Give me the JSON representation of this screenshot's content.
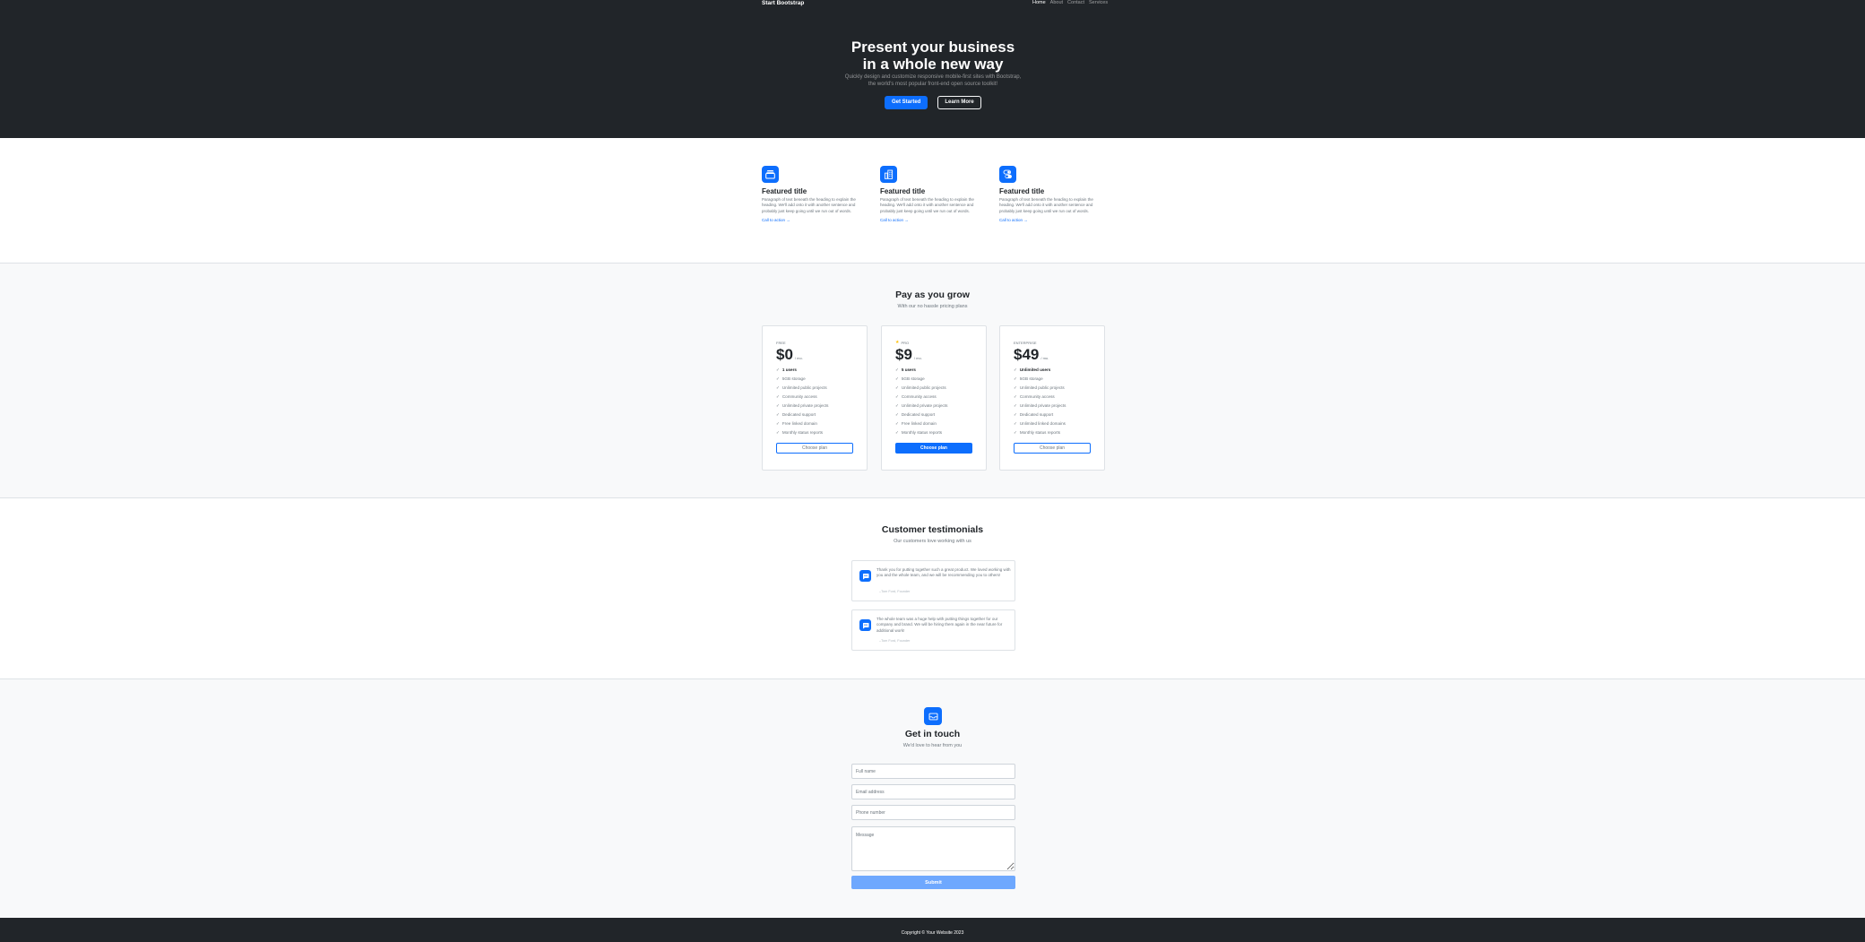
{
  "navbar": {
    "brand": "Start Bootstrap",
    "links": [
      {
        "label": "Home",
        "active": true
      },
      {
        "label": "About",
        "active": false
      },
      {
        "label": "Contact",
        "active": false
      },
      {
        "label": "Services",
        "active": false
      }
    ]
  },
  "hero": {
    "title": "Present your business in a whole new way",
    "lead": "Quickly design and customize responsive mobile-first sites with Bootstrap, the world's most popular front-end open source toolkit!",
    "primary_button": "Get Started",
    "secondary_button": "Learn More"
  },
  "features": [
    {
      "icon": "collection-icon",
      "title": "Featured title",
      "text": "Paragraph of text beneath the heading to explain the heading. We'll add onto it with another sentence and probably just keep going until we run out of words.",
      "link": "Call to action →"
    },
    {
      "icon": "building-icon",
      "title": "Featured title",
      "text": "Paragraph of text beneath the heading to explain the heading. We'll add onto it with another sentence and probably just keep going until we run out of words.",
      "link": "Call to action →"
    },
    {
      "icon": "toggles-icon",
      "title": "Featured title",
      "text": "Paragraph of text beneath the heading to explain the heading. We'll add onto it with another sentence and probably just keep going until we run out of words.",
      "link": "Call to action →"
    }
  ],
  "pricing": {
    "title": "Pay as you grow",
    "subtitle": "With our no hassle pricing plans",
    "check_glyph": "✓",
    "star_glyph": "★",
    "plans": [
      {
        "name": "Free",
        "price": "$0",
        "unit": "/ mo.",
        "featured": false,
        "button": "Choose plan",
        "features": [
          {
            "text": "1 users",
            "strong": true
          },
          {
            "text": "5GB storage",
            "strong": false
          },
          {
            "text": "Unlimited public projects",
            "strong": false
          },
          {
            "text": "Community access",
            "strong": false
          },
          {
            "text": "Unlimited private projects",
            "strong": false
          },
          {
            "text": "Dedicated support",
            "strong": false
          },
          {
            "text": "Free linked domain",
            "strong": false
          },
          {
            "text": "Monthly status reports",
            "strong": false
          }
        ]
      },
      {
        "name": "Pro",
        "price": "$9",
        "unit": "/ mo.",
        "featured": true,
        "button": "Choose plan",
        "features": [
          {
            "text": "5 users",
            "strong": true
          },
          {
            "text": "5GB storage",
            "strong": false
          },
          {
            "text": "Unlimited public projects",
            "strong": false
          },
          {
            "text": "Community access",
            "strong": false
          },
          {
            "text": "Unlimited private projects",
            "strong": false
          },
          {
            "text": "Dedicated support",
            "strong": false
          },
          {
            "text": "Free linked domain",
            "strong": false
          },
          {
            "text": "Monthly status reports",
            "strong": false
          }
        ]
      },
      {
        "name": "Enterprise",
        "price": "$49",
        "unit": "/ mo.",
        "featured": false,
        "button": "Choose plan",
        "features": [
          {
            "text": "Unlimited users",
            "strong": true
          },
          {
            "text": "5GB storage",
            "strong": false
          },
          {
            "text": "Unlimited public projects",
            "strong": false
          },
          {
            "text": "Community access",
            "strong": false
          },
          {
            "text": "Unlimited private projects",
            "strong": false
          },
          {
            "text": "Dedicated support",
            "strong": false
          },
          {
            "text": "Unlimited linked domains",
            "strong": false
          },
          {
            "text": "Monthly status reports",
            "strong": false
          }
        ]
      }
    ]
  },
  "testimonials": {
    "title": "Customer testimonials",
    "subtitle": "Our customers love working with us",
    "items": [
      {
        "text": "Thank you for putting together such a great product. We loved working with you and the whole team, and we will be recommending you to others!",
        "author": "–Tom Ford, Founder"
      },
      {
        "text": "The whole team was a huge help with putting things together for our company and brand. We will be hiring them again in the near future for additional work!",
        "author": "–Tom Ford, Founder"
      }
    ]
  },
  "contact": {
    "title": "Get in touch",
    "subtitle": "We'd love to hear from you",
    "name_placeholder": "Full name",
    "email_placeholder": "Email address",
    "phone_placeholder": "Phone number",
    "message_placeholder": "Message",
    "submit": "Submit"
  },
  "footer": {
    "copyright": "Copyright © Your Website 2023"
  },
  "colors": {
    "dark": "#212529",
    "primary": "#0d6efd",
    "light_bg": "#f8f9fa",
    "muted": "#6c757d"
  }
}
